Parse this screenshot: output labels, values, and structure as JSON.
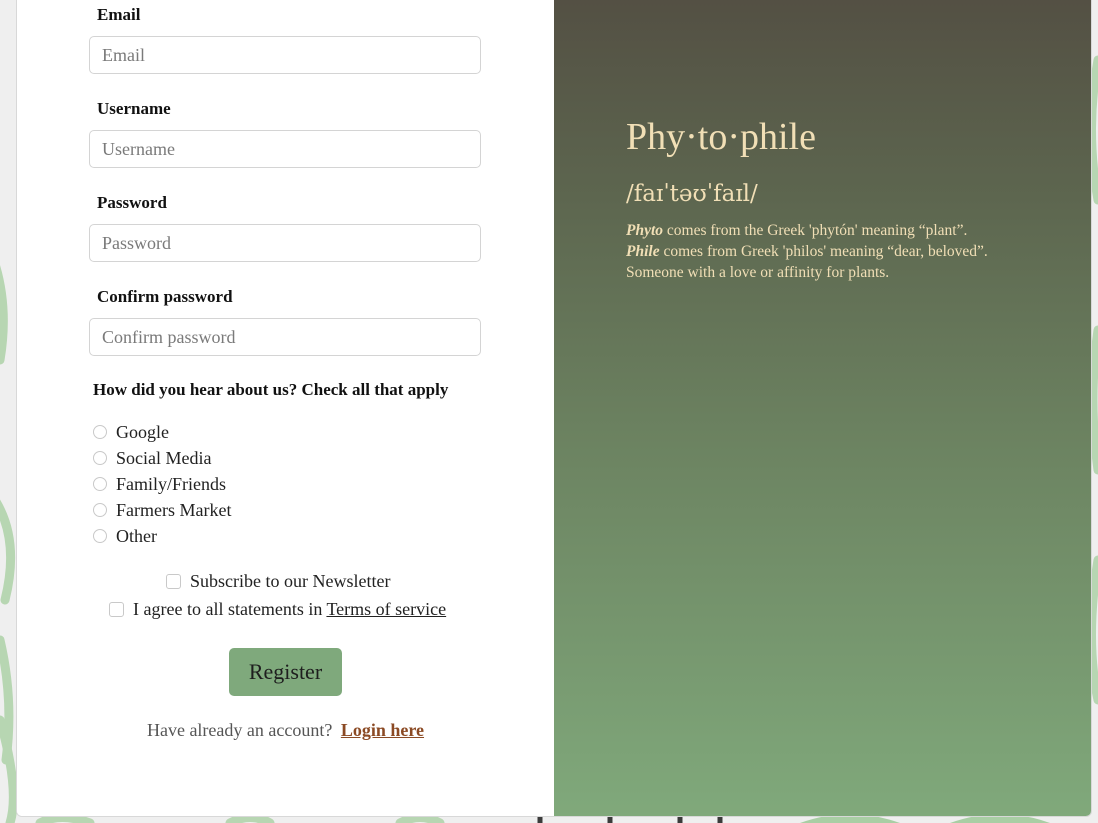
{
  "form": {
    "fields": [
      {
        "label": "Email",
        "placeholder": "Email"
      },
      {
        "label": "Username",
        "placeholder": "Username"
      },
      {
        "label": "Password",
        "placeholder": "Password"
      },
      {
        "label": "Confirm password",
        "placeholder": "Confirm password"
      }
    ],
    "question": "How did you hear about us? Check all that apply",
    "options": [
      "Google",
      "Social Media",
      "Family/Friends",
      "Farmers Market",
      "Other"
    ],
    "newsletter_label": "Subscribe to our Newsletter",
    "terms_prefix": "I agree to all statements in",
    "terms_link": "Terms of service",
    "register_label": "Register",
    "login_prompt": "Have already an account?",
    "login_link": "Login here"
  },
  "info": {
    "title": "Phy·to·phile",
    "phonetic": "/faɪˈtəʊˈfaɪl/",
    "lines": [
      {
        "term": "Phyto",
        "text": "comes from the Greek 'phytón' meaning “plant”."
      },
      {
        "term": "Phile",
        "text": "comes from Greek 'philos' meaning “dear, beloved”."
      },
      {
        "term": "",
        "text": "Someone with a love or affinity for plants."
      }
    ]
  },
  "colors": {
    "accent": "#7fa97c",
    "panel_text": "#f1dfb6",
    "link": "#8b4a24"
  }
}
